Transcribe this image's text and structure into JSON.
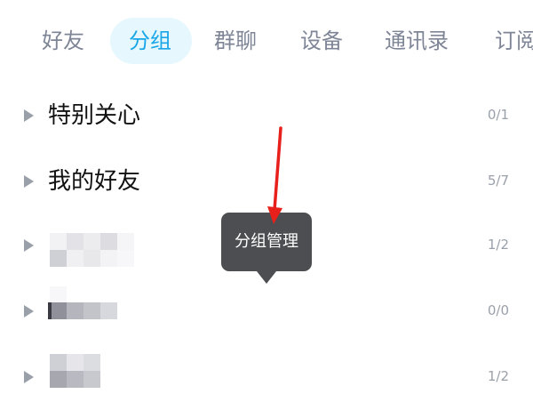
{
  "tabs": [
    {
      "label": "好友",
      "active": false
    },
    {
      "label": "分组",
      "active": true
    },
    {
      "label": "群聊",
      "active": false
    },
    {
      "label": "设备",
      "active": false
    },
    {
      "label": "通讯录",
      "active": false
    },
    {
      "label": "订阅",
      "active": false
    }
  ],
  "groups": [
    {
      "name": "特别关心",
      "count": "0/1"
    },
    {
      "name": "我的好友",
      "count": "5/7"
    },
    {
      "name": "",
      "count": "1/2"
    },
    {
      "name": "",
      "count": "0/0"
    },
    {
      "name": "",
      "count": "1/2"
    }
  ],
  "tooltip": {
    "label": "分组管理"
  },
  "colors": {
    "accent": "#1aa7e8",
    "tab_inactive": "#7e8596",
    "tab_active_bg": "#e6f7fd",
    "tooltip_bg": "#4d4e52",
    "annotation_arrow": "#e8201c"
  },
  "icons": {
    "group_expand": "caret-right-icon",
    "annotation": "red-arrow-icon"
  }
}
